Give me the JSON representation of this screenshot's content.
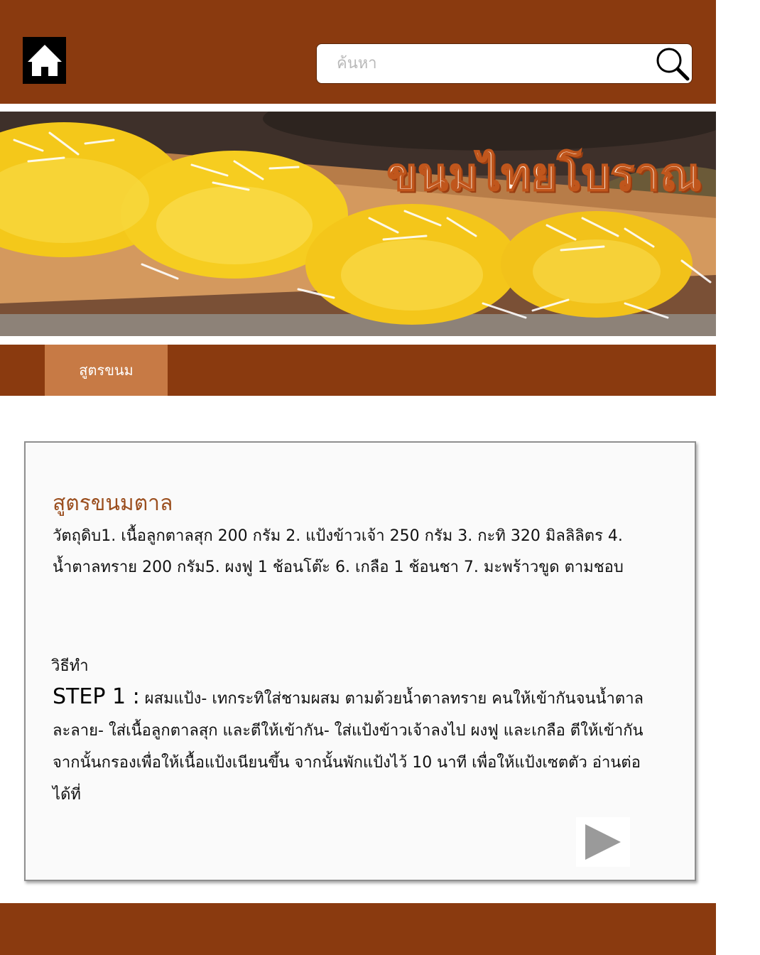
{
  "header": {
    "home_icon": "home-icon",
    "search": {
      "placeholder": "ค้นหา",
      "value": "",
      "icon": "search-icon"
    }
  },
  "banner": {
    "title": "ขนมไทยโบราณ"
  },
  "nav": {
    "tabs": [
      {
        "label": "สูตรขนม",
        "active": true
      }
    ]
  },
  "recipe": {
    "title": "สูตรขนมตาล",
    "ingredients": "วัตถุดิบ1. เนื้อลูกตาลสุก 200 กรัม 2. แป้งข้าวเจ้า 250 กรัม 3. กะทิ 320 มิลลิลิตร 4. น้ำตาลทราย 200 กรัม5. ผงฟู 1 ช้อนโต๊ะ 6. เกลือ 1 ช้อนชา 7. มะพร้าวขูด ตามชอบ",
    "method_heading": "วิธีทำ",
    "step_label": "STEP 1 :",
    "step_text": " ผสมแป้ง- เทกระทิใส่ชามผสม ตามด้วยน้ำตาลทราย คนให้เข้ากันจนน้ำตาลละลาย- ใส่เนื้อลูกตาลสุก และตีให้เข้ากัน- ใส่แป้งข้าวเจ้าลงไป ผงฟู และเกลือ ตีให้เข้ากัน จากนั้นกรองเพื่อให้เนื้อแป้งเนียนขึ้น จากนั้นพักแป้งไว้ 10 นาที เพื่อให้แป้งเซตตัว อ่านต่อได้ที่",
    "next_icon": "play-icon"
  },
  "colors": {
    "brand_brown": "#8a3a0f",
    "tab_active": "#c77a45",
    "title_accent": "#9b4f1f"
  }
}
